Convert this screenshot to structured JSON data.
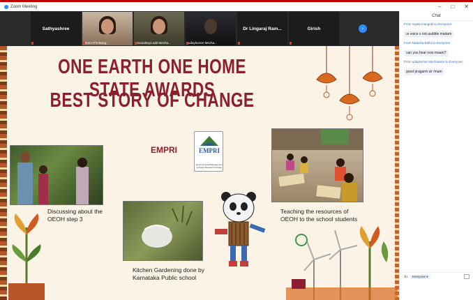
{
  "window": {
    "title": "Zoom Meeting"
  },
  "participants": [
    {
      "name": "Sathyashree",
      "type": "name"
    },
    {
      "name": "NAU-ITS-Bang...",
      "type": "video"
    },
    {
      "name": "Soundarya adit Mecha...",
      "type": "video"
    },
    {
      "name": "udaykumar Mecha...",
      "type": "video"
    },
    {
      "name": "Dr Lingaraj Ram...",
      "type": "name"
    },
    {
      "name": "Girish",
      "type": "name"
    }
  ],
  "slide": {
    "title_line1": "ONE EARTH ONE HOME STATE AWARDS",
    "title_line2": "BEST STORY OF CHANGE",
    "org": "EMPRI",
    "logo_text": "EMPRI",
    "logo_sub": "Environmental Management & Policy Research Institute",
    "caption1": [
      "Discussing about the",
      "OEOH step 3"
    ],
    "caption2": [
      "Teaching the resources of",
      "OEOH to the school students"
    ],
    "caption3": [
      "Kitchen Gardening done by",
      "Karnataka Public school"
    ]
  },
  "chat": {
    "title": "Chat",
    "messages": [
      {
        "from": "From sujata mangrab to Everyone:",
        "text": "ur voice s not audible madam"
      },
      {
        "from": "From Natasha Ballal to Everyone:",
        "text": "can you hear now maam?"
      },
      {
        "from": "From udaykumar Mechaware to Everyone:",
        "text": "good pragarm sir /mam"
      }
    ],
    "to_label": "To:",
    "to_value": "Everyone ▾"
  },
  "colors": {
    "zoom_blue": "#2d8cff",
    "title_red": "#8b1e2f",
    "slide_bg": "#fbf3e5"
  }
}
